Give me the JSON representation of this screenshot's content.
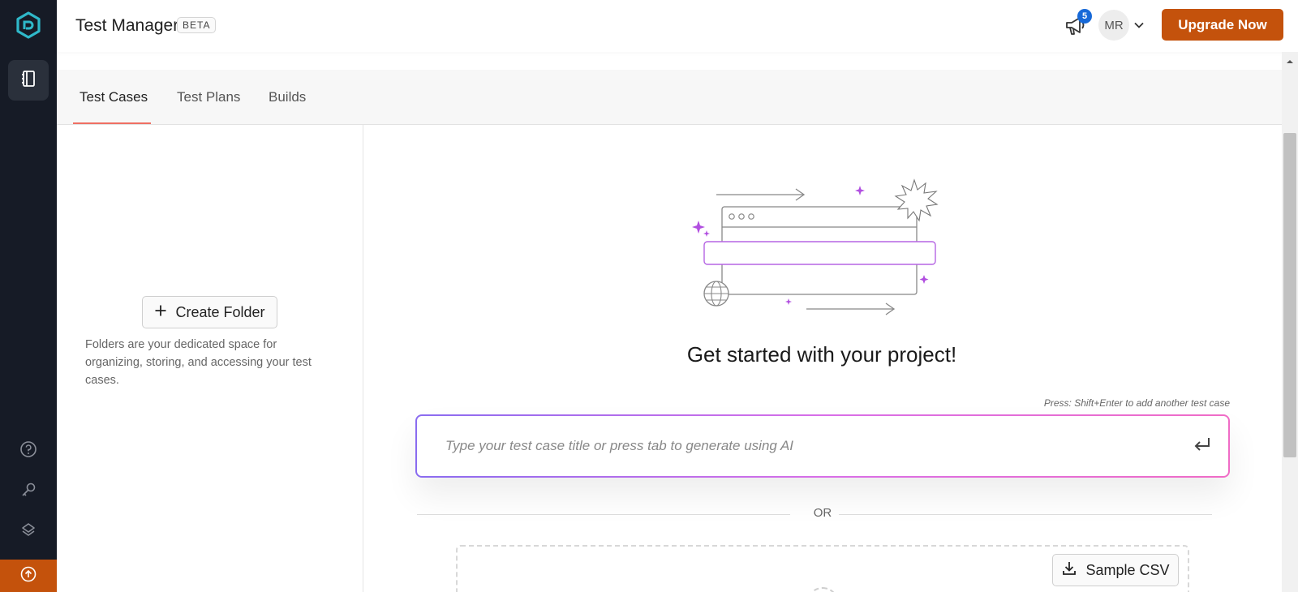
{
  "header": {
    "app_title": "Test Manager",
    "beta_badge": "BETA",
    "notification_count": "5",
    "avatar_initials": "MR",
    "upgrade_label": "Upgrade Now"
  },
  "tabs": [
    {
      "label": "Test Cases",
      "active": true
    },
    {
      "label": "Test Plans",
      "active": false
    },
    {
      "label": "Builds",
      "active": false
    }
  ],
  "sidebar": {
    "active_item_icon": "notebook-icon",
    "bottom_icons": [
      "help-icon",
      "key-icon",
      "layers-icon"
    ],
    "upgrade_icon": "arrow-up-circle-icon"
  },
  "folders": {
    "create_folder_label": "Create Folder",
    "description": "Folders are your dedicated space for organizing, storing, and accessing your test cases."
  },
  "main": {
    "heading": "Get started with your project!",
    "hint": "Press: Shift+Enter to add another test case",
    "input_placeholder": "Type your test case title or press tab to generate using AI",
    "or_label": "OR",
    "sample_csv_label": "Sample CSV"
  },
  "colors": {
    "rail_bg": "#161b26",
    "accent_orange": "#c4520c",
    "badge_blue": "#1769d8",
    "tab_underline": "#ef6f63",
    "gradient_start": "#8a6cf0",
    "gradient_end": "#f06cc6"
  }
}
